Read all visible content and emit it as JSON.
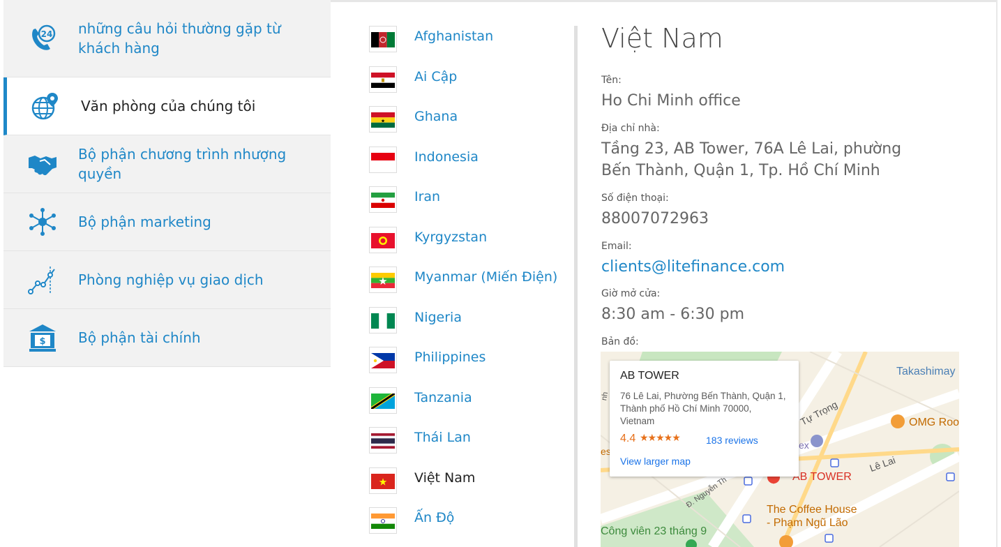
{
  "sidebar": {
    "items": [
      {
        "label": "những câu hỏi thường gặp từ khách hàng",
        "icon": "phone-24-icon"
      },
      {
        "label": "Văn phòng của chúng tôi",
        "icon": "globe-pin-icon"
      },
      {
        "label": "Bộ phận chương trình nhượng quyền",
        "icon": "handshake-icon"
      },
      {
        "label": "Bộ phận marketing",
        "icon": "network-icon"
      },
      {
        "label": "Phòng nghiệp vụ giao dịch",
        "icon": "chart-line-icon"
      },
      {
        "label": "Bộ phận tài chính",
        "icon": "bank-icon"
      }
    ],
    "active_index": 1,
    "accent": "#1e88c8"
  },
  "countries": [
    {
      "name": "Afghanistan"
    },
    {
      "name": "Ai Cập"
    },
    {
      "name": "Ghana"
    },
    {
      "name": "Indonesia"
    },
    {
      "name": "Iran"
    },
    {
      "name": "Kyrgyzstan"
    },
    {
      "name": "Myanmar (Miến Điện)"
    },
    {
      "name": "Nigeria"
    },
    {
      "name": "Philippines"
    },
    {
      "name": "Tanzania"
    },
    {
      "name": "Thái Lan"
    },
    {
      "name": "Việt Nam"
    },
    {
      "name": "Ấn Độ"
    }
  ],
  "detail": {
    "title": "Việt Nam",
    "name_label": "Tên:",
    "name_value": "Ho Chi Minh office",
    "address_label": "Địa chỉ nhà:",
    "address_value": "Tầng 23, AB Tower, 76A Lê Lai, phường Bến Thành, Quận 1, Tp. Hồ Chí Minh",
    "phone_label": "Số điện thoại:",
    "phone_value": "88007072963",
    "email_label": "Email:",
    "email_value": "clients@litefinance.com",
    "hours_label": "Giờ mở cửa:",
    "hours_value": "8:30 am - 6:30 pm",
    "map_label": "Bản đồ:"
  },
  "map": {
    "popup": {
      "title": "AB TOWER",
      "address": "76 Lê Lai, Phường Bến Thành, Quận 1, Thành phố Hồ Chí Minh 70000, Vietnam",
      "rating": "4.4",
      "stars": "★★★★★",
      "reviews": "183 reviews",
      "view_larger": "View larger map"
    },
    "labels": {
      "takashimaya": "Takashimay",
      "tu_trong": "Tự Trọng",
      "omg": "OMG Roo",
      "le_lai": "Lê Lai",
      "ab_tower": "AB TOWER",
      "coffee_1": "The Coffee House",
      "coffee_2": "- Phạm Ngũ Lão",
      "park": "Công viên 23 tháng 9",
      "nguyen": "Đ. Nguyễn Th",
      "ex": "ex",
      "es": "es",
      "nh": "nh"
    }
  }
}
